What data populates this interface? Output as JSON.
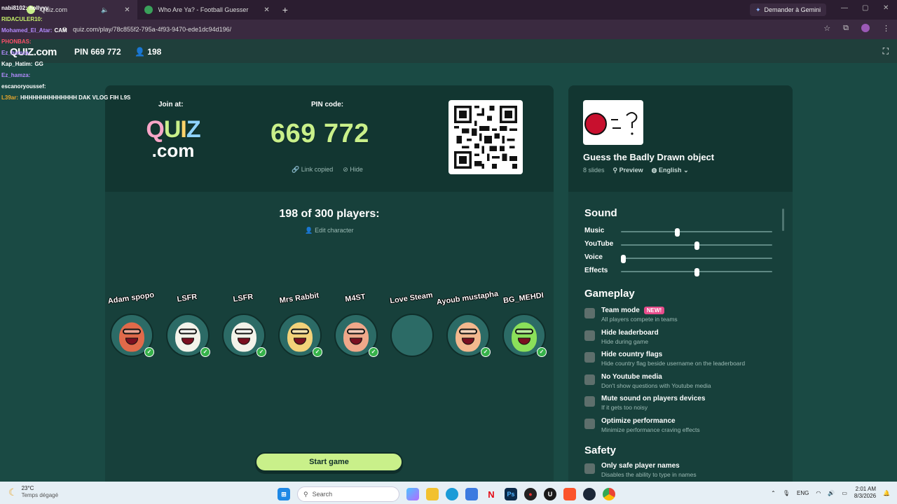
{
  "browser": {
    "tabs": [
      {
        "label": "Quiz.com",
        "active": true
      },
      {
        "label": "Who Are Ya? - Football Guesser",
        "active": false
      }
    ],
    "gemini_label": "Demander à Gemini",
    "url": "quiz.com/play/78c855f2-795a-4f93-9470-ede1dc94d196/"
  },
  "header": {
    "logo": "QUIZ.com",
    "pin_label": "PIN 669 772",
    "player_count": "198"
  },
  "chat": [
    {
      "user": "nabi8102:",
      "msg": "hollyyy",
      "color": "#ffffff"
    },
    {
      "user": "RIDACULER10:",
      "msg": "",
      "color": "#c7f26a"
    },
    {
      "user": "Mohamed_El_Atar:",
      "msg": "CAM",
      "color": "#b48cff"
    },
    {
      "user": "PHONBAS:",
      "msg": "",
      "color": "#ff4d6a"
    },
    {
      "user": "Ez_hamza:",
      "msg": "",
      "color": "#b48cff"
    },
    {
      "user": "Kap_Hatim:",
      "msg": "GG",
      "color": "#ffffff"
    },
    {
      "user": "Ez_hamza:",
      "msg": "",
      "color": "#b48cff"
    },
    {
      "user": "escanoryoussef:",
      "msg": "",
      "color": "#ffffff"
    },
    {
      "user": "L39ar:",
      "msg": "HHHHHHHHHHHHHH DAK VLOG FIH L9S",
      "color": "#e8a62c"
    }
  ],
  "join": {
    "join_at_label": "Join at:",
    "logo_top": "QUIZ",
    "logo_bottom": ".com",
    "pin_code_label": "PIN code:",
    "pin": "669 772",
    "link_copied": "Link copied",
    "hide": "Hide"
  },
  "lobby": {
    "players_title": "198 of 300 players:",
    "edit_character": "Edit character",
    "players": [
      {
        "name": "Adam spopo",
        "face": "#e06a4a",
        "checked": true
      },
      {
        "name": "LSFR",
        "face": "#f3f3ea",
        "checked": true
      },
      {
        "name": "LSFR",
        "face": "#f3f3ea",
        "checked": true
      },
      {
        "name": "Mrs Rabbit",
        "face": "#f3d27a",
        "checked": true
      },
      {
        "name": "M4ST",
        "face": "#f0a88a",
        "checked": true
      },
      {
        "name": "Love Steam",
        "face": "",
        "checked": false
      },
      {
        "name": "Ayoub mustapha",
        "face": "#f4b88e",
        "checked": true
      },
      {
        "name": "BG_MEHDI",
        "face": "#8be05a",
        "checked": true
      }
    ],
    "start_button": "Start game"
  },
  "quiz": {
    "title": "Guess the Badly Drawn object",
    "slides": "8 slides",
    "preview": "Preview",
    "language": "English"
  },
  "settings": {
    "sound_title": "Sound",
    "sliders": [
      {
        "label": "Music",
        "value": 0.37
      },
      {
        "label": "YouTube",
        "value": 0.5
      },
      {
        "label": "Voice",
        "value": 0.0
      },
      {
        "label": "Effects",
        "value": 0.5
      }
    ],
    "gameplay_title": "Gameplay",
    "gameplay": [
      {
        "title": "Team mode",
        "desc": "All players compete in teams",
        "badge": "NEW!"
      },
      {
        "title": "Hide leaderboard",
        "desc": "Hide during game",
        "badge": ""
      },
      {
        "title": "Hide country flags",
        "desc": "Hide country flag beside username on the leaderboard",
        "badge": ""
      },
      {
        "title": "No Youtube media",
        "desc": "Don't show questions with Youtube media",
        "badge": ""
      },
      {
        "title": "Mute sound on players devices",
        "desc": "If it gets too noisy",
        "badge": ""
      },
      {
        "title": "Optimize performance",
        "desc": "Minimize performance craving effects",
        "badge": ""
      }
    ],
    "safety_title": "Safety",
    "safety": [
      {
        "title": "Only safe player names",
        "desc": "Disables the ability to type in names"
      }
    ]
  },
  "taskbar": {
    "temp": "23°C",
    "weather": "Temps dégagé",
    "search": "Search",
    "lang": "ENG",
    "time": "2:01 AM",
    "date": "8/3/2026"
  },
  "colors": {
    "accent_green": "#c9f08a",
    "bg": "#1a4a44",
    "panel": "#17403b",
    "new_badge": "#e74c8b"
  }
}
